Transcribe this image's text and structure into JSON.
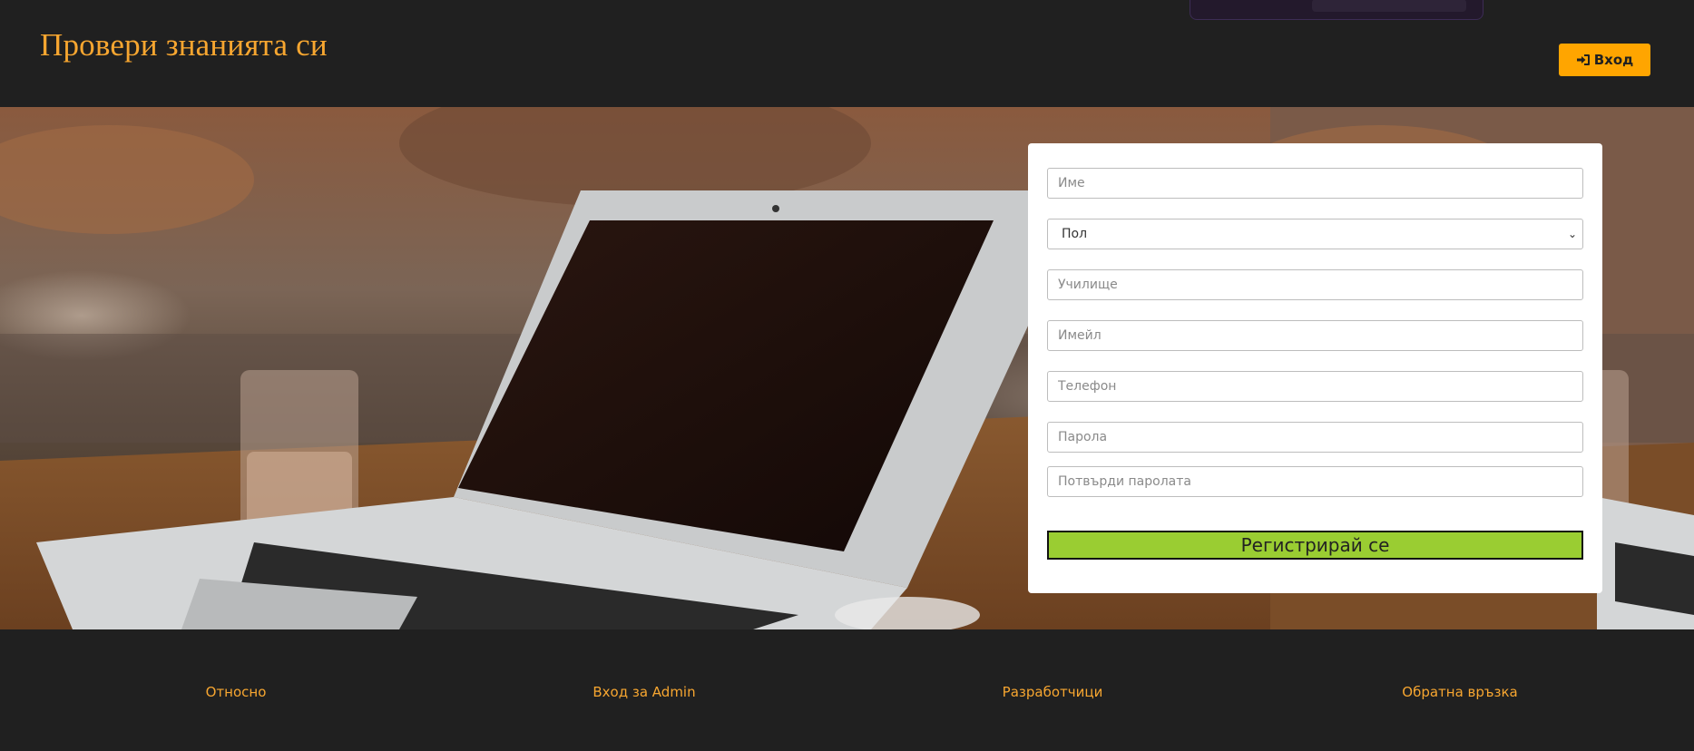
{
  "header": {
    "site_title": "Провери знанията си",
    "login_label": "Вход",
    "login_icon": "sign-in-icon"
  },
  "colors": {
    "accent": "#f7a630",
    "login_button": "#ffa500",
    "submit_button": "#9acd32",
    "background": "#202020"
  },
  "form": {
    "name_placeholder": "Име",
    "gender_selected": "Пол",
    "school_placeholder": "Училище",
    "email_placeholder": "Имейл",
    "phone_placeholder": "Телефон",
    "password_placeholder": "Парола",
    "confirm_password_placeholder": "Потвърди паролата",
    "submit_label": "Регистрирай се"
  },
  "footer": {
    "links": [
      "Относно",
      "Вход за Admin",
      "Разработчици",
      "Обратна връзка"
    ]
  }
}
